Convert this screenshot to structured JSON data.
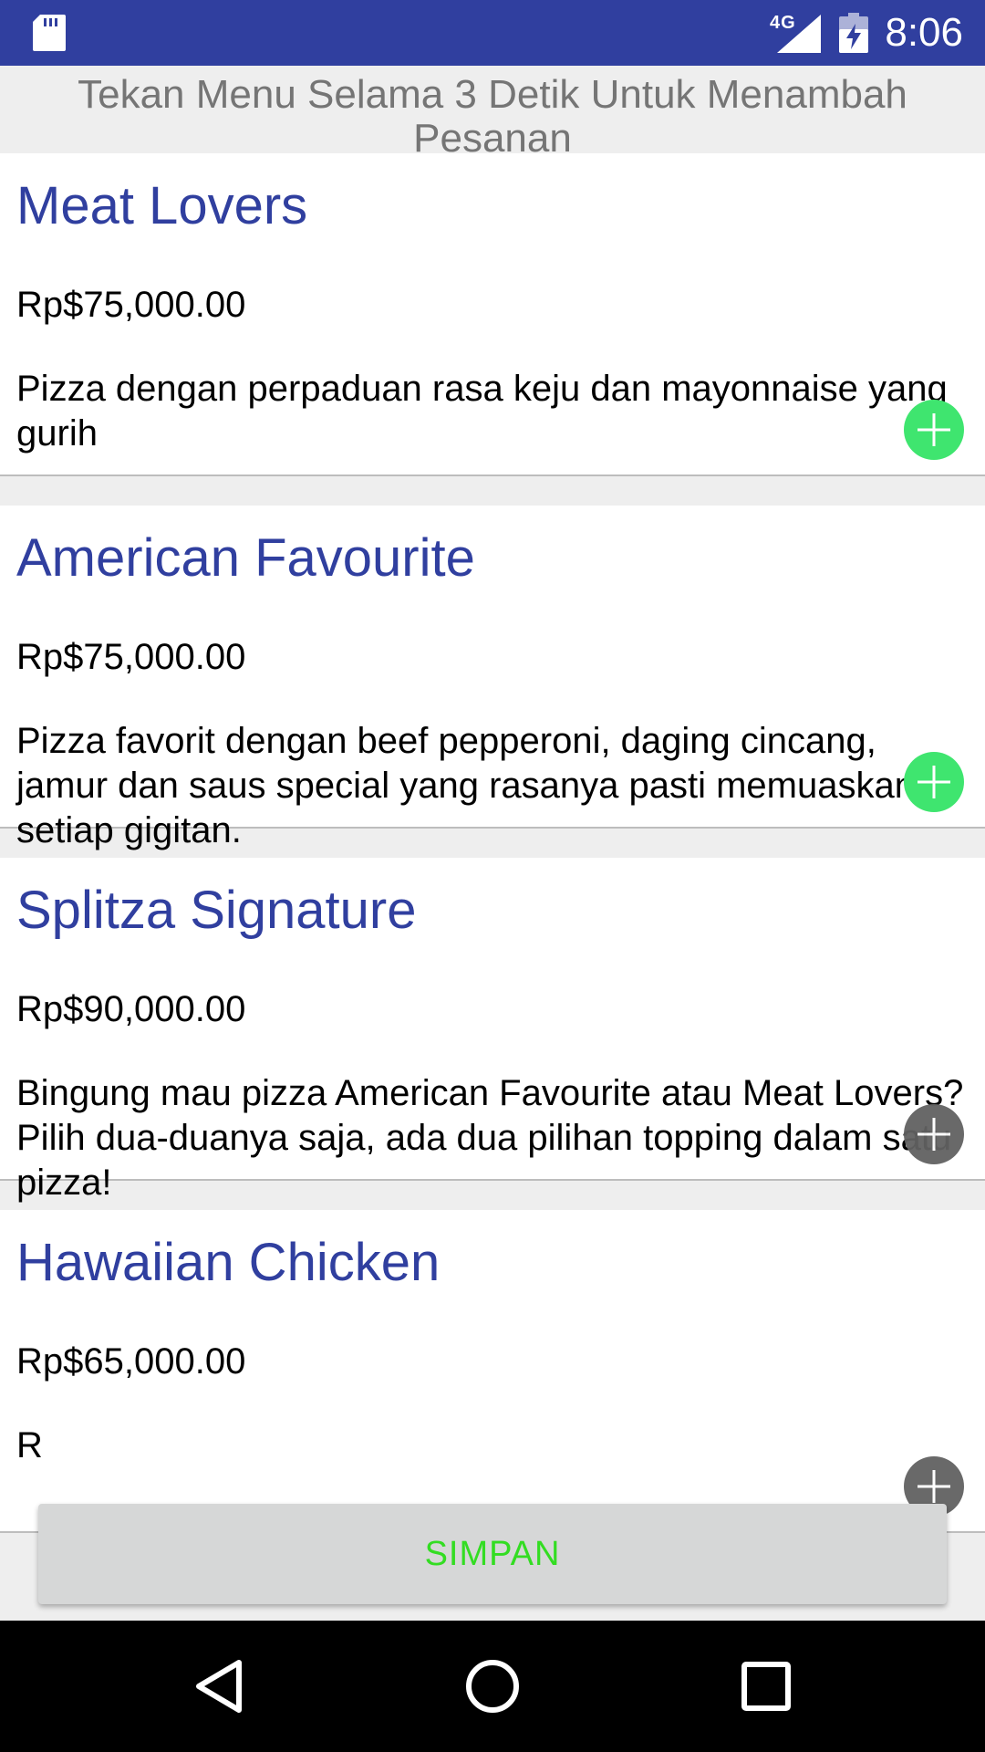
{
  "status_bar": {
    "network": "4G",
    "time": "8:06",
    "icons": [
      "sd-card-icon",
      "signal-icon",
      "battery-charging-icon"
    ]
  },
  "hint": "Tekan Menu Selama 3 Detik Untuk Menambah Pesanan",
  "menu_items": [
    {
      "name": "Meat Lovers",
      "price": "Rp$75,000.00",
      "description": "Pizza dengan perpaduan rasa keju dan mayonnaise yang gurih",
      "add_state": "active"
    },
    {
      "name": "American Favourite",
      "price": "Rp$75,000.00",
      "description": "Pizza favorit dengan beef pepperoni, daging cincang, jamur dan saus special yang rasanya pasti memuaskan di setiap gigitan.",
      "add_state": "active"
    },
    {
      "name": "Splitza Signature",
      "price": "Rp$90,000.00",
      "description": "Bingung mau pizza American Favourite atau Meat Lovers? Pilih dua-duanya saja, ada dua pilihan topping dalam satu pizza!",
      "add_state": "inactive"
    },
    {
      "name": "Hawaiian Chicken",
      "price": "Rp$65,000.00",
      "description": "R",
      "add_state": "inactive"
    }
  ],
  "save_label": "SIMPAN",
  "colors": {
    "primary": "#303f9f",
    "add_active": "#3fe56f",
    "add_inactive": "#616161",
    "save_text": "#33dd22"
  },
  "nav": {
    "icons": [
      "back-icon",
      "home-icon",
      "recents-icon"
    ]
  }
}
